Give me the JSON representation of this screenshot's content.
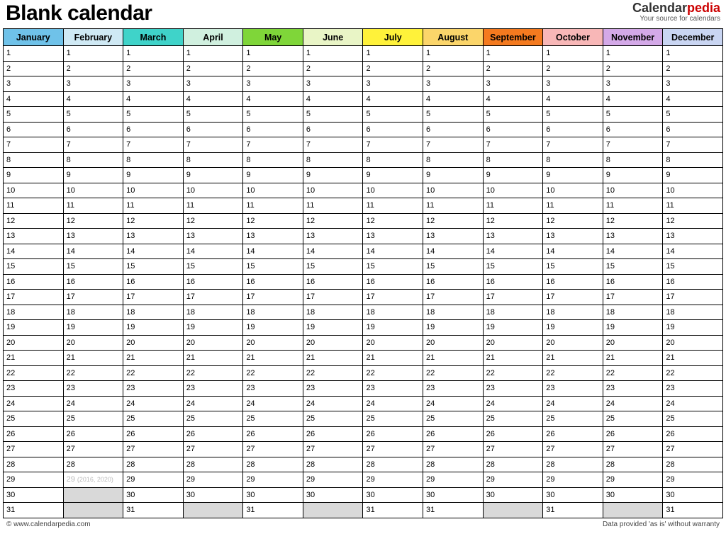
{
  "header": {
    "title": "Blank calendar",
    "brand_prefix": "Calendar",
    "brand_suffix": "pedia",
    "brand_tagline": "Your source for calendars"
  },
  "months": [
    {
      "name": "January",
      "color": "#6fc2e9",
      "days": 31
    },
    {
      "name": "February",
      "color": "#cfe9f4",
      "days": 29,
      "leap_day": 29,
      "leap_note": "(2016, 2020)"
    },
    {
      "name": "March",
      "color": "#3fd3c9",
      "days": 31
    },
    {
      "name": "April",
      "color": "#d0f0df",
      "days": 30
    },
    {
      "name": "May",
      "color": "#7fd639",
      "days": 31
    },
    {
      "name": "June",
      "color": "#e9f5c6",
      "days": 30
    },
    {
      "name": "July",
      "color": "#fff23a",
      "days": 31
    },
    {
      "name": "August",
      "color": "#fbd56a",
      "days": 31
    },
    {
      "name": "September",
      "color": "#f47a1f",
      "days": 30
    },
    {
      "name": "October",
      "color": "#f8b7b7",
      "days": 31
    },
    {
      "name": "November",
      "color": "#d4a9e8",
      "days": 30
    },
    {
      "name": "December",
      "color": "#c9d5f2",
      "days": 31
    }
  ],
  "max_rows": 31,
  "footer": {
    "left": "© www.calendarpedia.com",
    "right": "Data provided 'as is' without warranty"
  }
}
